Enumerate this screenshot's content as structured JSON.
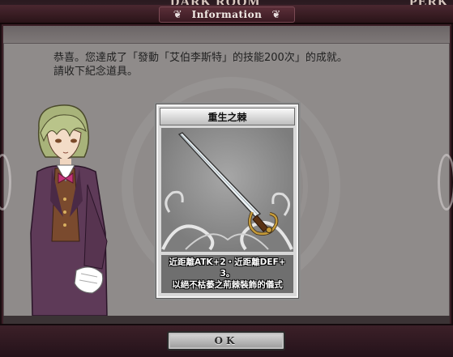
{
  "background": {
    "text_left": "DARK ROOM",
    "text_right": "PERK"
  },
  "dialog": {
    "title": "Information",
    "message_line1": "恭喜。您達成了「發動「艾伯李斯特」的技能200次」的成就。",
    "message_line2": "請收下紀念道具。"
  },
  "item_card": {
    "name": "重生之棘",
    "description_line1": "近距離ATK+2・近距離DEF+",
    "description_line2": "3。",
    "description_line3": "以絕不枯萎之荊棘裝飾的儀式"
  },
  "buttons": {
    "ok_label": "OK"
  },
  "colors": {
    "frame": "#3a1e25",
    "panel": "#8f8b8a",
    "card": "#d8d8d8"
  },
  "icons": [
    "ornament-left-icon",
    "ornament-right-icon",
    "sword-icon"
  ]
}
